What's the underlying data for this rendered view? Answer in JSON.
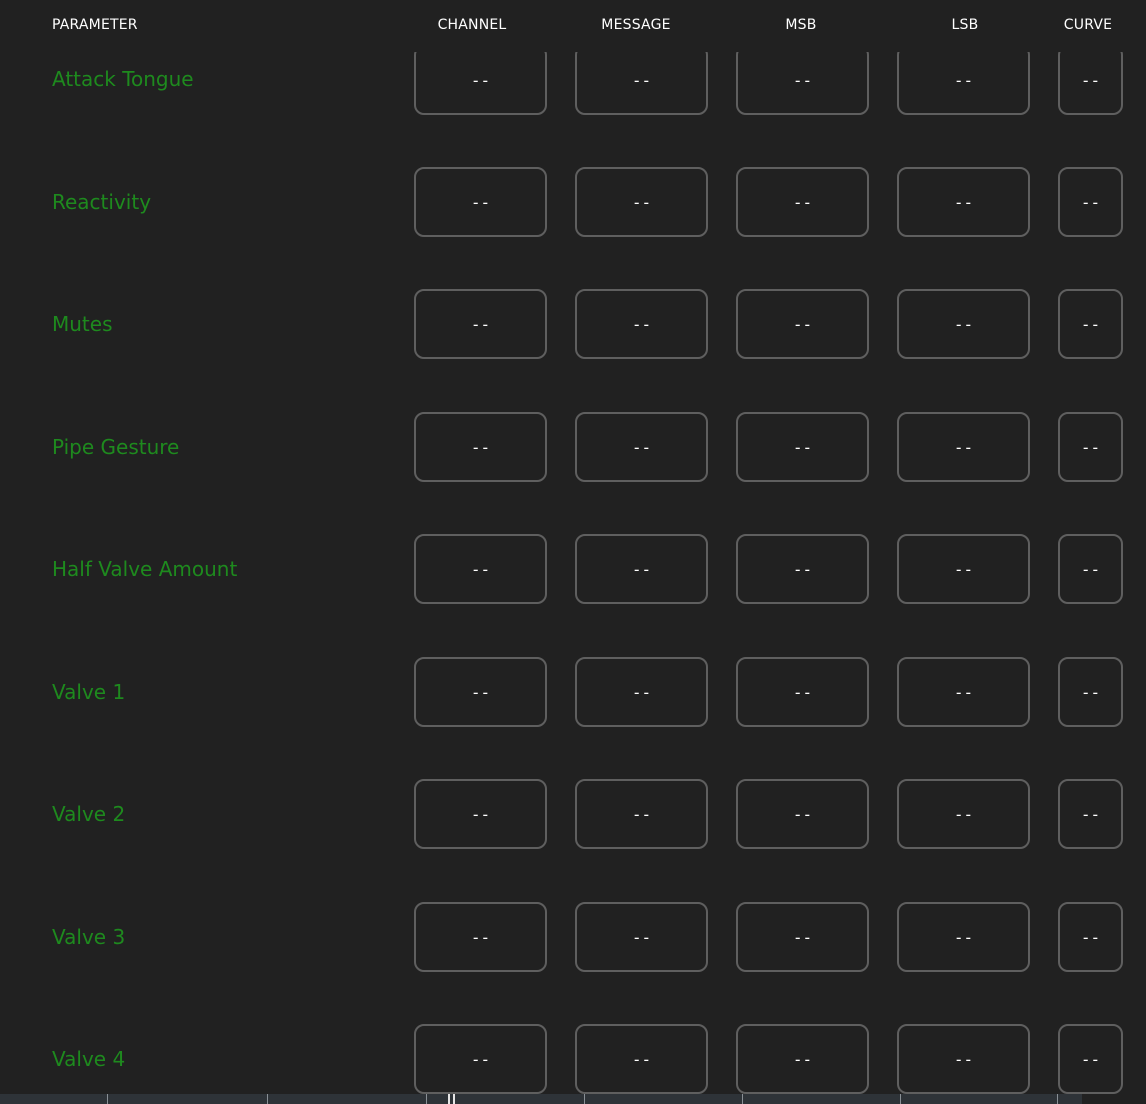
{
  "header": {
    "parameter": "PARAMETER",
    "channel": "CHANNEL",
    "message": "MESSAGE",
    "msb": "MSB",
    "lsb": "LSB",
    "curve": "CURVE"
  },
  "rows": [
    {
      "label": "Attack Tongue",
      "channel": "--",
      "message": "--",
      "msb": "--",
      "lsb": "--",
      "curve": "--"
    },
    {
      "label": "Reactivity",
      "channel": "--",
      "message": "--",
      "msb": "--",
      "lsb": "--",
      "curve": "--"
    },
    {
      "label": "Mutes",
      "channel": "--",
      "message": "--",
      "msb": "--",
      "lsb": "--",
      "curve": "--"
    },
    {
      "label": "Pipe Gesture",
      "channel": "--",
      "message": "--",
      "msb": "--",
      "lsb": "--",
      "curve": "--"
    },
    {
      "label": "Half Valve Amount",
      "channel": "--",
      "message": "--",
      "msb": "--",
      "lsb": "--",
      "curve": "--"
    },
    {
      "label": "Valve 1",
      "channel": "--",
      "message": "--",
      "msb": "--",
      "lsb": "--",
      "curve": "--"
    },
    {
      "label": "Valve 2",
      "channel": "--",
      "message": "--",
      "msb": "--",
      "lsb": "--",
      "curve": "--"
    },
    {
      "label": "Valve 3",
      "channel": "--",
      "message": "--",
      "msb": "--",
      "lsb": "--",
      "curve": "--"
    },
    {
      "label": "Valve 4",
      "channel": "--",
      "message": "--",
      "msb": "--",
      "lsb": "--",
      "curve": "--"
    }
  ],
  "colors": {
    "background": "#212121",
    "parameter_label": "#1e8a1e",
    "cell_border": "#5f5f5f",
    "header_text": "#ffffff"
  }
}
